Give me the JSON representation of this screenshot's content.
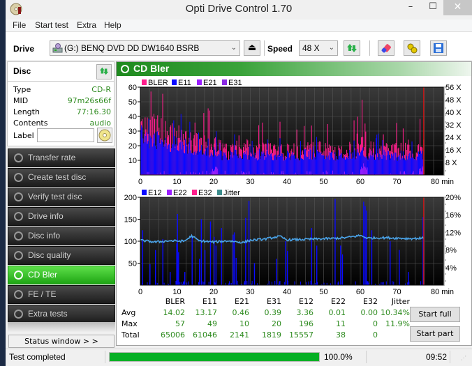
{
  "window": {
    "title": "Opti Drive Control 1.70",
    "minimize": "–",
    "maximize": "☐",
    "close": "✕"
  },
  "menu": [
    "File",
    "Start test",
    "Extra",
    "Help"
  ],
  "toolbar": {
    "drive_label": "Drive",
    "drive_value": "(G:)  BENQ DVD DD DW1640 BSRB",
    "speed_label": "Speed",
    "speed_value": "48 X"
  },
  "disc": {
    "title": "Disc",
    "rows": [
      {
        "key": "Type",
        "value": "CD-R"
      },
      {
        "key": "MID",
        "value": "97m26s66f"
      },
      {
        "key": "Length",
        "value": "77:16.30"
      },
      {
        "key": "Contents",
        "value": "audio"
      }
    ],
    "label_key": "Label",
    "label_value": ""
  },
  "nav": [
    {
      "label": "Transfer rate",
      "active": false
    },
    {
      "label": "Create test disc",
      "active": false
    },
    {
      "label": "Verify test disc",
      "active": false
    },
    {
      "label": "Drive info",
      "active": false
    },
    {
      "label": "Disc info",
      "active": false
    },
    {
      "label": "Disc quality",
      "active": false
    },
    {
      "label": "CD Bler",
      "active": true
    },
    {
      "label": "FE / TE",
      "active": false
    },
    {
      "label": "Extra tests",
      "active": false
    }
  ],
  "status_window_label": "Status window > >",
  "panel_title": "CD Bler",
  "chart_data": [
    {
      "type": "bar",
      "title": "",
      "legend": [
        {
          "name": "BLER",
          "color": "#ff1e8c"
        },
        {
          "name": "E11",
          "color": "#0a0aff"
        },
        {
          "name": "E21",
          "color": "#9b1eff"
        },
        {
          "name": "E31",
          "color": "#8a2be2"
        }
      ],
      "legend_position": "top-left",
      "xlabel": "min",
      "xlim": [
        0,
        80
      ],
      "x_ticks": [
        "0",
        "10",
        "20",
        "30",
        "40",
        "50",
        "60",
        "70",
        "80 min"
      ],
      "ylim": [
        0,
        60
      ],
      "y_ticks": [
        "10",
        "20",
        "30",
        "40",
        "50",
        "60"
      ],
      "y2_ticks": [
        "8 X",
        "16 X",
        "24 X",
        "32 X",
        "40 X",
        "48 X",
        "56 X"
      ],
      "y2lim": [
        0,
        56
      ],
      "end_marker_min": 77.3,
      "series_summary": {
        "BLER": {
          "typical_early": 30,
          "typical_late": 18,
          "max": 57
        },
        "E11": {
          "typical_early": 25,
          "typical_late": 14,
          "max": 49
        },
        "E21": {
          "typical": 1,
          "max": 10
        },
        "E31": {
          "typical": 1,
          "max": 20
        }
      },
      "profile_x": [
        0,
        2,
        4,
        6,
        8,
        10,
        12,
        14,
        16,
        18,
        20,
        22,
        24,
        26,
        28,
        30,
        35,
        40,
        45,
        50,
        55,
        60,
        61,
        62,
        65,
        70,
        75,
        77
      ],
      "profile_bler": [
        35,
        33,
        32,
        30,
        27,
        28,
        26,
        24,
        22,
        21,
        22,
        18,
        17,
        18,
        18,
        17,
        17,
        17,
        18,
        18,
        17,
        20,
        30,
        18,
        18,
        17,
        17,
        18
      ],
      "profile_e11": [
        30,
        28,
        27,
        25,
        22,
        23,
        21,
        20,
        18,
        17,
        17,
        15,
        14,
        15,
        15,
        14,
        14,
        14,
        15,
        15,
        14,
        15,
        17,
        14,
        15,
        14,
        14,
        15
      ]
    },
    {
      "type": "bar",
      "title": "",
      "legend": [
        {
          "name": "E12",
          "color": "#0a0aff"
        },
        {
          "name": "E22",
          "color": "#9b1eff"
        },
        {
          "name": "E32",
          "color": "#ff1e8c"
        },
        {
          "name": "Jitter",
          "color": "#3c8c8c"
        }
      ],
      "legend_position": "top-left",
      "xlabel": "min",
      "xlim": [
        0,
        80
      ],
      "x_ticks": [
        "0",
        "10",
        "20",
        "30",
        "40",
        "50",
        "60",
        "70",
        "80 min"
      ],
      "ylim": [
        0,
        200
      ],
      "y_ticks": [
        "50",
        "100",
        "150",
        "200"
      ],
      "y2_ticks": [
        "4%",
        "8%",
        "12%",
        "16%",
        "20%"
      ],
      "y2lim": [
        0,
        20
      ],
      "end_marker_min": 77.3,
      "e12_spikes": [
        {
          "x": 0.5,
          "y": 125
        },
        {
          "x": 2.5,
          "y": 48
        },
        {
          "x": 4,
          "y": 80
        },
        {
          "x": 6,
          "y": 105
        },
        {
          "x": 8,
          "y": 30
        },
        {
          "x": 9.8,
          "y": 95
        },
        {
          "x": 10,
          "y": 162
        },
        {
          "x": 10.3,
          "y": 75
        },
        {
          "x": 12,
          "y": 30
        },
        {
          "x": 14,
          "y": 110
        },
        {
          "x": 16,
          "y": 60
        },
        {
          "x": 16.5,
          "y": 150
        },
        {
          "x": 17.5,
          "y": 80
        },
        {
          "x": 19,
          "y": 145
        },
        {
          "x": 20,
          "y": 110
        },
        {
          "x": 20.5,
          "y": 90
        },
        {
          "x": 22,
          "y": 130
        },
        {
          "x": 25.2,
          "y": 115
        },
        {
          "x": 25.5,
          "y": 120
        },
        {
          "x": 26,
          "y": 62
        },
        {
          "x": 28.6,
          "y": 153
        },
        {
          "x": 29.5,
          "y": 192
        },
        {
          "x": 31,
          "y": 50
        },
        {
          "x": 37,
          "y": 60
        },
        {
          "x": 39.5,
          "y": 100
        },
        {
          "x": 40,
          "y": 78
        },
        {
          "x": 46.6,
          "y": 130
        },
        {
          "x": 48,
          "y": 90
        },
        {
          "x": 53,
          "y": 196
        },
        {
          "x": 54.5,
          "y": 90
        },
        {
          "x": 55,
          "y": 70
        },
        {
          "x": 60.8,
          "y": 190
        },
        {
          "x": 61.2,
          "y": 180
        },
        {
          "x": 61.5,
          "y": 170
        },
        {
          "x": 63,
          "y": 125
        },
        {
          "x": 68,
          "y": 100
        },
        {
          "x": 70.5,
          "y": 80
        },
        {
          "x": 73,
          "y": 30
        },
        {
          "x": 77,
          "y": 155
        }
      ],
      "jitter_profile_x": [
        0,
        4,
        8,
        12,
        14,
        16,
        20,
        24,
        28,
        30,
        34,
        38,
        40,
        44,
        48,
        52,
        56,
        60,
        62,
        66,
        70,
        74,
        77
      ],
      "jitter_profile_pct": [
        10.2,
        9.8,
        10.1,
        10.0,
        11.2,
        10.1,
        9.8,
        10.1,
        9.7,
        10.2,
        10.5,
        11.1,
        10.3,
        10.4,
        10.5,
        10.6,
        10.8,
        11.3,
        10.7,
        10.8,
        10.7,
        10.6,
        10.7
      ]
    }
  ],
  "stats": {
    "columns": [
      "BLER",
      "E11",
      "E21",
      "E31",
      "E12",
      "E22",
      "E32",
      "Jitter"
    ],
    "rows": [
      {
        "label": "Avg",
        "values": [
          "14.02",
          "13.17",
          "0.46",
          "0.39",
          "3.36",
          "0.01",
          "0.00",
          "10.34%"
        ]
      },
      {
        "label": "Max",
        "values": [
          "57",
          "49",
          "10",
          "20",
          "196",
          "11",
          "0",
          "11.9%"
        ]
      },
      {
        "label": "Total",
        "values": [
          "65006",
          "61046",
          "2141",
          "1819",
          "15557",
          "38",
          "0",
          ""
        ]
      }
    ]
  },
  "buttons": {
    "start_full": "Start full",
    "start_part": "Start part"
  },
  "statusbar": {
    "message": "Test completed",
    "progress_percent": 100,
    "progress_text": "100.0%",
    "time": "09:52"
  }
}
